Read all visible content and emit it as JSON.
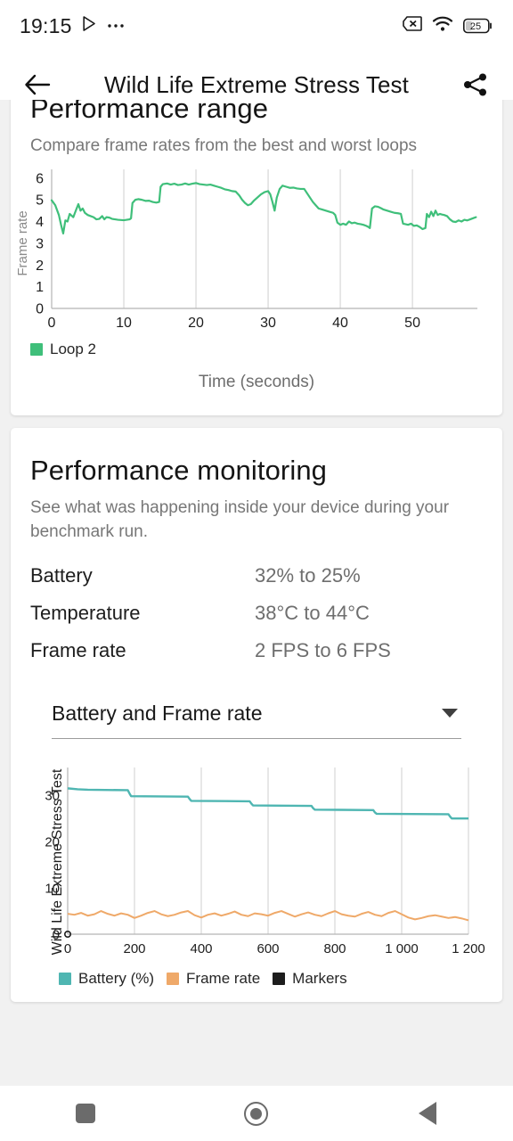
{
  "status_bar": {
    "time": "19:15",
    "play_icon": "play-triangle-icon",
    "overflow_icon": "more-dots-icon",
    "no_sim_icon": "no-sim-icon",
    "wifi_icon": "wifi-icon",
    "battery_icon": "battery-icon",
    "battery_level": "25"
  },
  "app_bar": {
    "back_icon": "arrow-back-icon",
    "title": "Wild Life Extreme Stress Test",
    "share_icon": "share-icon"
  },
  "performance_range": {
    "title": "Performance range",
    "subtitle": "Compare frame rates from the best and worst loops",
    "legend": [
      {
        "label": "Loop 2",
        "color": "#3fbf7a"
      }
    ],
    "x_axis_title": "Time (seconds)"
  },
  "performance_monitoring": {
    "title": "Performance monitoring",
    "subtitle": "See what was happening inside your device during your benchmark run.",
    "stats": [
      {
        "key": "Battery",
        "value": "32% to 25%"
      },
      {
        "key": "Temperature",
        "value": "38°C to 44°C"
      },
      {
        "key": "Frame rate",
        "value": "2 FPS to 6 FPS"
      }
    ],
    "dropdown": {
      "value": "Battery and Frame rate",
      "caret_icon": "chevron-down-icon"
    },
    "legend": [
      {
        "label": "Battery (%)",
        "color": "#4fb6b2"
      },
      {
        "label": "Frame rate",
        "color": "#efa969"
      },
      {
        "label": "Markers",
        "color": "#1d1d1d"
      }
    ]
  },
  "nav_bar": {
    "recents_icon": "square-recents-icon",
    "home_icon": "circle-home-icon",
    "back_icon": "triangle-back-icon"
  },
  "chart_data": [
    {
      "id": "performance-range-chart",
      "type": "line",
      "title": "Performance range",
      "xlabel": "Time (seconds)",
      "ylabel": "Frame rate",
      "xlim": [
        0,
        59
      ],
      "ylim": [
        0,
        6.4
      ],
      "xticks": [
        0,
        10,
        20,
        30,
        40,
        50
      ],
      "yticks": [
        0,
        1,
        2,
        3,
        4,
        5,
        6
      ],
      "grid": "vertical",
      "legend_position": "bottom-left",
      "series": [
        {
          "name": "Loop 2",
          "color": "#3fbf7a",
          "x": [
            0,
            0.5,
            1,
            1.3,
            1.6,
            1.9,
            2.2,
            2.5,
            3,
            3.4,
            3.7,
            4,
            4.3,
            4.6,
            5,
            5.4,
            5.8,
            6.2,
            6.6,
            7,
            7.3,
            7.6,
            8,
            8.4,
            8.8,
            9.2,
            9.6,
            10,
            10.4,
            10.8,
            11,
            11.2,
            11.6,
            12,
            12.5,
            13,
            13.5,
            14,
            14.5,
            14.9,
            15.1,
            15.4,
            16,
            16.5,
            17,
            17.5,
            18,
            18.5,
            19,
            19.5,
            20,
            20.5,
            21,
            21.5,
            22,
            22.5,
            23,
            23.5,
            24,
            24.5,
            25,
            25.5,
            26,
            26.4,
            26.8,
            27.2,
            27.6,
            28,
            28.5,
            29,
            29.5,
            30,
            30.3,
            30.6,
            30.9,
            31.2,
            31.6,
            32,
            32.5,
            33,
            33.5,
            34,
            34.5,
            35,
            35.4,
            35.8,
            36.2,
            36.6,
            37,
            37.5,
            38,
            38.5,
            39,
            39.3,
            39.6,
            40,
            40.4,
            40.8,
            41.2,
            41.6,
            42,
            42.4,
            42.8,
            43.2,
            43.6,
            43.9,
            44.1,
            44.4,
            44.8,
            45.2,
            45.6,
            46,
            46.5,
            47,
            47.5,
            48,
            48.4,
            48.7,
            49,
            49.4,
            49.8,
            50.2,
            50.6,
            51,
            51.4,
            51.8,
            52,
            52.3,
            52.6,
            52.9,
            53.2,
            53.5,
            53.8,
            54.1,
            54.4,
            54.8,
            55.2,
            55.6,
            56,
            56.4,
            56.8,
            57.2,
            57.6,
            58,
            58.4,
            58.8
          ],
          "y": [
            4.98,
            4.75,
            4.3,
            3.85,
            3.45,
            4.05,
            4.0,
            4.35,
            4.2,
            4.55,
            4.8,
            4.5,
            4.6,
            4.4,
            4.3,
            4.25,
            4.2,
            4.1,
            4.12,
            4.25,
            4.1,
            4.2,
            4.18,
            4.12,
            4.1,
            4.08,
            4.07,
            4.06,
            4.08,
            4.1,
            4.15,
            4.85,
            5.0,
            5.03,
            5.0,
            4.95,
            4.96,
            4.9,
            4.87,
            4.9,
            5.6,
            5.72,
            5.75,
            5.7,
            5.74,
            5.68,
            5.7,
            5.75,
            5.7,
            5.74,
            5.77,
            5.72,
            5.7,
            5.68,
            5.7,
            5.65,
            5.6,
            5.55,
            5.48,
            5.45,
            5.4,
            5.38,
            5.2,
            5.0,
            4.85,
            4.75,
            4.8,
            4.95,
            5.1,
            5.25,
            5.35,
            5.4,
            5.25,
            4.9,
            4.5,
            5.1,
            5.5,
            5.65,
            5.6,
            5.55,
            5.56,
            5.52,
            5.5,
            5.5,
            5.3,
            5.1,
            4.9,
            4.75,
            4.6,
            4.55,
            4.5,
            4.45,
            4.4,
            4.3,
            3.95,
            3.85,
            3.9,
            3.85,
            4.0,
            3.92,
            3.95,
            3.9,
            3.88,
            3.85,
            3.8,
            3.75,
            3.7,
            4.6,
            4.7,
            4.68,
            4.62,
            4.55,
            4.5,
            4.45,
            4.4,
            4.38,
            4.35,
            3.9,
            3.88,
            3.85,
            3.9,
            3.8,
            3.82,
            3.75,
            3.65,
            3.7,
            4.35,
            4.2,
            4.45,
            4.25,
            4.5,
            4.3,
            4.35,
            4.32,
            4.3,
            4.25,
            4.1,
            4.0,
            3.98,
            4.05,
            4.0,
            4.08,
            4.05,
            4.1,
            4.15,
            4.2
          ]
        }
      ]
    },
    {
      "id": "performance-monitoring-chart",
      "type": "line",
      "ylabel": "Wild Life Extreme Stress Test",
      "xlim": [
        0,
        1200
      ],
      "ylim": [
        0,
        36
      ],
      "xticks": [
        0,
        200,
        400,
        600,
        800,
        1000,
        1200
      ],
      "xtick_labels": [
        "0",
        "200",
        "400",
        "600",
        "800",
        "1 000",
        "1 200"
      ],
      "yticks": [
        0,
        10,
        20,
        30
      ],
      "grid": "vertical",
      "legend_position": "bottom",
      "series": [
        {
          "name": "Battery (%)",
          "color": "#4fb6b2",
          "x": [
            0,
            30,
            60,
            180,
            185,
            190,
            360,
            365,
            370,
            545,
            550,
            555,
            730,
            735,
            740,
            915,
            920,
            925,
            1140,
            1145,
            1150,
            1200
          ],
          "y": [
            31.5,
            31.3,
            31.2,
            31.1,
            30.4,
            29.8,
            29.7,
            29.2,
            28.8,
            28.7,
            28.2,
            27.8,
            27.7,
            27.2,
            26.9,
            26.8,
            26.3,
            26.0,
            25.9,
            25.4,
            25.0,
            25.0
          ]
        },
        {
          "name": "Frame rate",
          "color": "#efa969",
          "x": [
            0,
            20,
            40,
            60,
            80,
            100,
            120,
            140,
            160,
            180,
            200,
            220,
            240,
            260,
            280,
            300,
            320,
            340,
            360,
            380,
            400,
            420,
            440,
            460,
            480,
            500,
            520,
            540,
            560,
            580,
            600,
            620,
            640,
            660,
            680,
            700,
            720,
            740,
            760,
            780,
            800,
            820,
            840,
            860,
            880,
            900,
            920,
            940,
            960,
            980,
            1000,
            1020,
            1040,
            1060,
            1080,
            1100,
            1120,
            1140,
            1160,
            1180,
            1200
          ],
          "y": [
            4.4,
            4.2,
            4.6,
            4.0,
            4.3,
            5.0,
            4.4,
            4.0,
            4.5,
            4.2,
            3.5,
            4.0,
            4.6,
            5.0,
            4.3,
            3.9,
            4.2,
            4.7,
            5.0,
            4.1,
            3.6,
            4.2,
            4.5,
            4.0,
            4.4,
            4.9,
            4.2,
            3.9,
            4.5,
            4.3,
            4.0,
            4.6,
            5.0,
            4.4,
            3.8,
            4.3,
            4.7,
            4.2,
            3.9,
            4.5,
            5.0,
            4.3,
            4.0,
            3.8,
            4.4,
            4.8,
            4.2,
            3.9,
            4.6,
            5.0,
            4.3,
            3.6,
            3.2,
            3.5,
            3.9,
            4.1,
            3.8,
            3.5,
            3.7,
            3.4,
            3.0
          ]
        },
        {
          "name": "Markers",
          "color": "#1d1d1d",
          "marker_points": [
            {
              "x": 0,
              "y": 0
            }
          ]
        }
      ]
    }
  ]
}
